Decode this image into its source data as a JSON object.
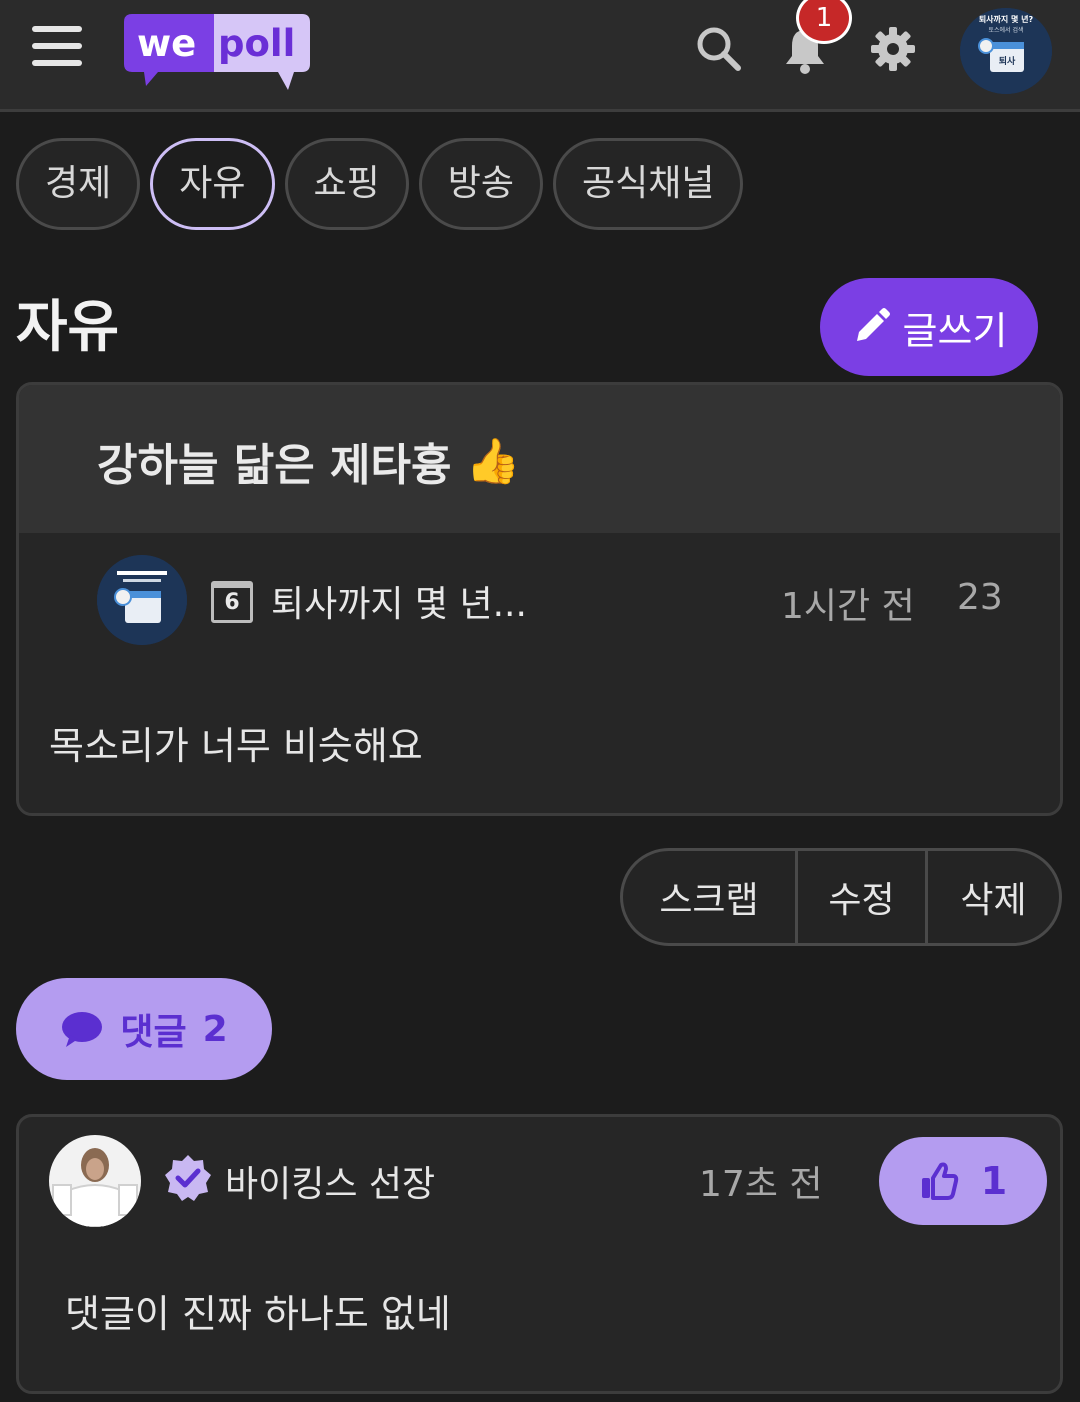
{
  "header": {
    "logo_left": "we",
    "logo_right": "poll",
    "notification_count": "1",
    "menu_icon": "hamburger-menu-icon",
    "search_icon": "search-icon",
    "bell_icon": "bell-icon",
    "settings_icon": "gear-icon",
    "avatar_text_top": "퇴사까지 몇 년?",
    "avatar_text_mid": "토스에서 검색",
    "avatar_text_cal": "퇴사"
  },
  "tabs": [
    {
      "label": "경제",
      "active": false
    },
    {
      "label": "자유",
      "active": true
    },
    {
      "label": "쇼핑",
      "active": false
    },
    {
      "label": "방송",
      "active": false
    },
    {
      "label": "공식채널",
      "active": false
    }
  ],
  "page": {
    "title": "자유",
    "write_label": "글쓰기"
  },
  "post": {
    "title": "강하늘 닮은 제타흉",
    "title_emoji": "👍",
    "author_level": "6",
    "author_name": "퇴사까지 몇 년...",
    "time": "1시간 전",
    "views": "23",
    "body": "목소리가 너무 비슷해요"
  },
  "actions": {
    "scrap": "스크랩",
    "edit": "수정",
    "delete": "삭제"
  },
  "comments_pill": {
    "label": "댓글",
    "count": "2"
  },
  "comment": {
    "author": "바이킹스 선장",
    "time": "17초 전",
    "likes": "1",
    "body": "댓글이 진짜 하나도 없네"
  },
  "colors": {
    "accent": "#7b3fe4",
    "accent_light": "#b49cf0",
    "background": "#1c1c1c",
    "badge_red": "#c62828"
  }
}
